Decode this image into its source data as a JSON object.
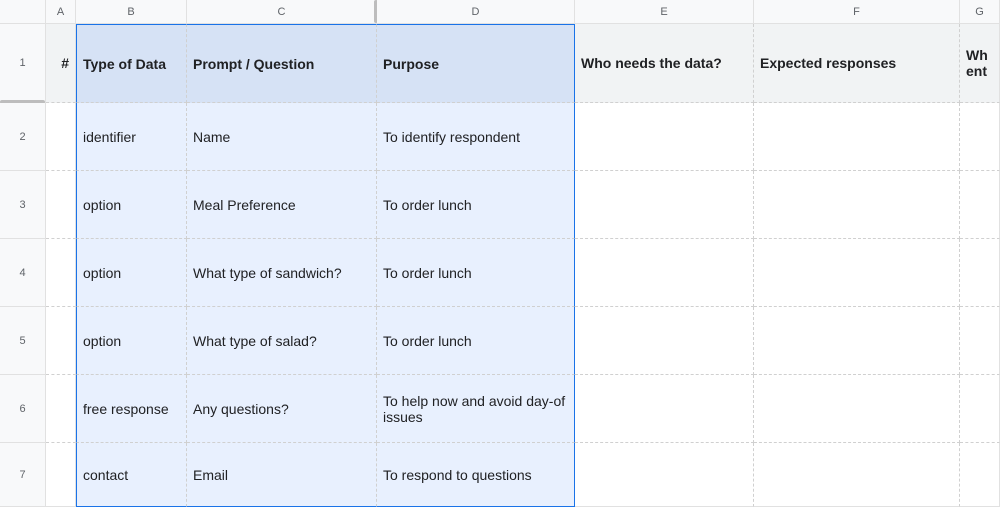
{
  "columns": {
    "A": "A",
    "B": "B",
    "C": "C",
    "D": "D",
    "E": "E",
    "F": "F",
    "G": "G"
  },
  "rowNumbers": {
    "r1": "1",
    "r2": "2",
    "r3": "3",
    "r4": "4",
    "r5": "5",
    "r6": "6",
    "r7": "7"
  },
  "header": {
    "A": "#",
    "B": "Type of Data",
    "C": "Prompt / Question",
    "D": "Purpose",
    "E": "Who needs the data?",
    "F": "Expected responses",
    "G": "Who enters the data?"
  },
  "rows": {
    "r2": {
      "B": "identifier",
      "C": "Name",
      "D": "To identify respondent"
    },
    "r3": {
      "B": "option",
      "C": "Meal Preference",
      "D": "To order lunch"
    },
    "r4": {
      "B": "option",
      "C": "What type of sandwich?",
      "D": "To order lunch"
    },
    "r5": {
      "B": "option",
      "C": "What type of salad?",
      "D": "To order lunch"
    },
    "r6": {
      "B": "free response",
      "C": "Any questions?",
      "D": "To help now and avoid day-of issues"
    },
    "r7": {
      "B": "contact",
      "C": "Email",
      "D": "To respond to questions"
    }
  },
  "truncated": {
    "G_header": "Wh ent"
  }
}
